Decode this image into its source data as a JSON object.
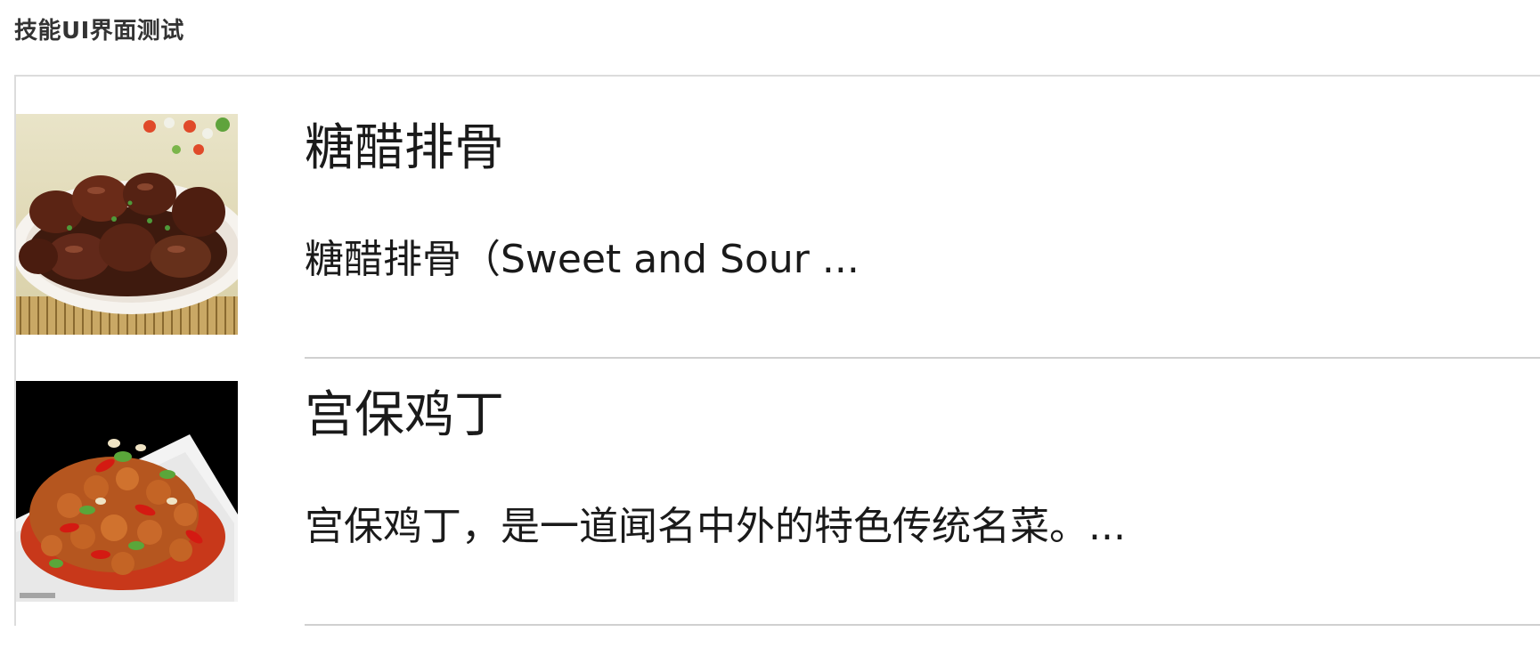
{
  "header": {
    "title": "技能UI界面测试"
  },
  "list": {
    "items": [
      {
        "title": "糖醋排骨",
        "description": "糖醋排骨（Sweet and Sour ...",
        "image_alt": "sweet-and-sour-ribs-photo"
      },
      {
        "title": "宫保鸡丁",
        "description": "宫保鸡丁，是一道闻名中外的特色传统名菜。...",
        "image_alt": "kung-pao-chicken-photo"
      }
    ]
  },
  "colors": {
    "divider": "#d0d0d0",
    "panel_border": "#dcdcdc",
    "text": "#1a1a1a",
    "header_text": "#333333"
  }
}
